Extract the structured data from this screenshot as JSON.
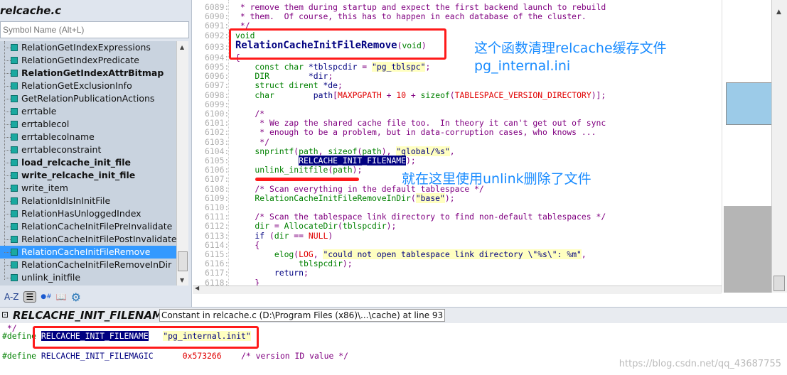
{
  "left": {
    "file_title": "relcache.c",
    "search_placeholder": "Symbol Name (Alt+L)",
    "symbols": [
      {
        "label": "RelationGetIndexExpressions",
        "bold": false
      },
      {
        "label": "RelationGetIndexPredicate",
        "bold": false
      },
      {
        "label": "RelationGetIndexAttrBitmap",
        "bold": true
      },
      {
        "label": "RelationGetExclusionInfo",
        "bold": false
      },
      {
        "label": "GetRelationPublicationActions",
        "bold": false
      },
      {
        "label": "errtable",
        "bold": false
      },
      {
        "label": "errtablecol",
        "bold": false
      },
      {
        "label": "errtablecolname",
        "bold": false
      },
      {
        "label": "errtableconstraint",
        "bold": false
      },
      {
        "label": "load_relcache_init_file",
        "bold": true
      },
      {
        "label": "write_relcache_init_file",
        "bold": true
      },
      {
        "label": "write_item",
        "bold": false
      },
      {
        "label": "RelationIdIsInInitFile",
        "bold": false
      },
      {
        "label": "RelationHasUnloggedIndex",
        "bold": false
      },
      {
        "label": "RelationCacheInitFilePreInvalidate",
        "bold": false
      },
      {
        "label": "RelationCacheInitFilePostInvalidate",
        "bold": false
      },
      {
        "label": "RelationCacheInitFileRemove",
        "bold": false,
        "selected": true
      },
      {
        "label": "RelationCacheInitFileRemoveInDir",
        "bold": false
      },
      {
        "label": "unlink_initfile",
        "bold": false
      }
    ],
    "toolbar": {
      "az": "A-Z",
      "list": "☰",
      "symtypes": "●#",
      "book": "📖",
      "gear": "⚙"
    }
  },
  "code": {
    "lines": [
      {
        "n": "6089:",
        "t": [
          [
            " * remove them during startup and expect the first backend launch to rebuild",
            "c"
          ]
        ]
      },
      {
        "n": "6090:",
        "t": [
          [
            " * them.  Of course, this has to happen in each database of the cluster.",
            "c"
          ]
        ]
      },
      {
        "n": "6091:",
        "t": [
          [
            " */",
            "c"
          ]
        ]
      },
      {
        "n": "6092:",
        "t": [
          [
            "void",
            "k"
          ]
        ]
      },
      {
        "n": "6093:",
        "big": true,
        "t": [
          [
            "RelationCacheInitFileRemove",
            "big"
          ],
          [
            "(",
            "p"
          ],
          [
            "void",
            "k"
          ],
          [
            ")",
            "p"
          ]
        ]
      },
      {
        "n": "6094:",
        "t": [
          [
            "{",
            "p"
          ]
        ]
      },
      {
        "n": "6095:",
        "t": [
          [
            "    const char ",
            "k"
          ],
          [
            "*tblspcdir",
            "n"
          ],
          [
            " = ",
            "p"
          ],
          [
            "\"pg_tblspc\"",
            "s"
          ],
          [
            ";",
            "p"
          ]
        ]
      },
      {
        "n": "6096:",
        "t": [
          [
            "    DIR        ",
            "k"
          ],
          [
            "*dir",
            "n"
          ],
          [
            ";",
            "p"
          ]
        ]
      },
      {
        "n": "6097:",
        "t": [
          [
            "    struct dirent ",
            "k"
          ],
          [
            "*de",
            "n"
          ],
          [
            ";",
            "p"
          ]
        ]
      },
      {
        "n": "6098:",
        "t": [
          [
            "    char        ",
            "k"
          ],
          [
            "path",
            "n"
          ],
          [
            "[",
            "p"
          ],
          [
            "MAXPGPATH",
            "m"
          ],
          [
            " + ",
            "p"
          ],
          [
            "10",
            "m"
          ],
          [
            " + ",
            "p"
          ],
          [
            "sizeof",
            "k"
          ],
          [
            "(",
            "p"
          ],
          [
            "TABLESPACE_VERSION_DIRECTORY",
            "m"
          ],
          [
            ")];",
            "p"
          ]
        ]
      },
      {
        "n": "6099:",
        "t": []
      },
      {
        "n": "6100:",
        "t": [
          [
            "    /*",
            "c"
          ]
        ]
      },
      {
        "n": "6101:",
        "t": [
          [
            "     * We zap the shared cache file too.  In theory it can't get out of sync",
            "c"
          ]
        ]
      },
      {
        "n": "6102:",
        "t": [
          [
            "     * enough to be a problem, but in data-corruption cases, who knows ...",
            "c"
          ]
        ]
      },
      {
        "n": "6103:",
        "t": [
          [
            "     */",
            "c"
          ]
        ]
      },
      {
        "n": "6104:",
        "t": [
          [
            "    snprintf",
            "k"
          ],
          [
            "(",
            "p"
          ],
          [
            "path",
            "k"
          ],
          [
            ", ",
            "p"
          ],
          [
            "sizeof",
            "k"
          ],
          [
            "(",
            "p"
          ],
          [
            "path",
            "k"
          ],
          [
            "), ",
            "p"
          ],
          [
            "\"global/%s\"",
            "s"
          ],
          [
            ",",
            "p"
          ]
        ]
      },
      {
        "n": "6105:",
        "t": [
          [
            "             ",
            ""
          ],
          [
            "RELCACHE_INIT_FILENAME",
            "h"
          ],
          [
            ");",
            "p"
          ]
        ]
      },
      {
        "n": "6106:",
        "t": [
          [
            "    unlink_initfile",
            "k"
          ],
          [
            "(",
            "p"
          ],
          [
            "path",
            "k"
          ],
          [
            ");",
            "p"
          ]
        ]
      },
      {
        "n": "6107:",
        "t": []
      },
      {
        "n": "6108:",
        "t": [
          [
            "    /* Scan everything in the default tablespace */",
            "c"
          ]
        ]
      },
      {
        "n": "6109:",
        "t": [
          [
            "    RelationCacheInitFileRemoveInDir",
            "k"
          ],
          [
            "(",
            "p"
          ],
          [
            "\"base\"",
            "s"
          ],
          [
            ");",
            "p"
          ]
        ]
      },
      {
        "n": "6110:",
        "t": []
      },
      {
        "n": "6111:",
        "t": [
          [
            "    /* Scan the tablespace link directory to find non-default tablespaces */",
            "c"
          ]
        ]
      },
      {
        "n": "6112:",
        "t": [
          [
            "    dir",
            "k"
          ],
          [
            " = ",
            "p"
          ],
          [
            "AllocateDir",
            "k"
          ],
          [
            "(",
            "p"
          ],
          [
            "tblspcdir",
            "k"
          ],
          [
            ");",
            "p"
          ]
        ]
      },
      {
        "n": "6113:",
        "t": [
          [
            "    if ",
            "n"
          ],
          [
            "(",
            "p"
          ],
          [
            "dir",
            "k"
          ],
          [
            " == ",
            "p"
          ],
          [
            "NULL",
            "m"
          ],
          [
            ")",
            "p"
          ]
        ]
      },
      {
        "n": "6114:",
        "t": [
          [
            "    {",
            "p"
          ]
        ]
      },
      {
        "n": "6115:",
        "t": [
          [
            "        elog",
            "k"
          ],
          [
            "(",
            "p"
          ],
          [
            "LOG",
            "m"
          ],
          [
            ", ",
            "p"
          ],
          [
            "\"could not open tablespace link directory \\\"%s\\\": %m\"",
            "s"
          ],
          [
            ",",
            "p"
          ]
        ]
      },
      {
        "n": "6116:",
        "t": [
          [
            "             tblspcdir",
            "k"
          ],
          [
            ");",
            "p"
          ]
        ]
      },
      {
        "n": "6117:",
        "t": [
          [
            "        return",
            "n"
          ],
          [
            ";",
            "p"
          ]
        ]
      },
      {
        "n": "6118:",
        "t": [
          [
            "    }",
            "p"
          ]
        ]
      }
    ]
  },
  "context": {
    "symbol": "RELCACHE_INIT_FILENAME",
    "description": "Constant in relcache.c (D:\\Program Files (x86)\\...\\cache) at line 93"
  },
  "bottom": {
    "lines": [
      [
        [
          " */",
          "c"
        ]
      ],
      [
        [
          "#define ",
          "k"
        ],
        [
          "RELCACHE_INIT_FILENAME",
          "h"
        ],
        [
          "   ",
          ""
        ],
        [
          "\"pg_internal.init\"",
          "s"
        ]
      ],
      [],
      [
        [
          "#define ",
          "k"
        ],
        [
          "RELCACHE_INIT_FILEMAGIC",
          "n"
        ],
        [
          "      ",
          ""
        ],
        [
          "0x573266",
          "m"
        ],
        [
          "    ",
          ""
        ],
        [
          "/* version ID value */",
          "c"
        ]
      ]
    ]
  },
  "annotations": {
    "func_note_1": "这个函数清理relcache缓存文件",
    "func_note_2": "pg_internal.ini",
    "unlink_note": "就在这里使用unlink删除了文件"
  },
  "watermark": "https://blog.csdn.net/qq_43687755",
  "colors": {
    "annotation": "#1a8cff",
    "highlight_box": "#ff1a1a",
    "selection": "#3399ff"
  }
}
